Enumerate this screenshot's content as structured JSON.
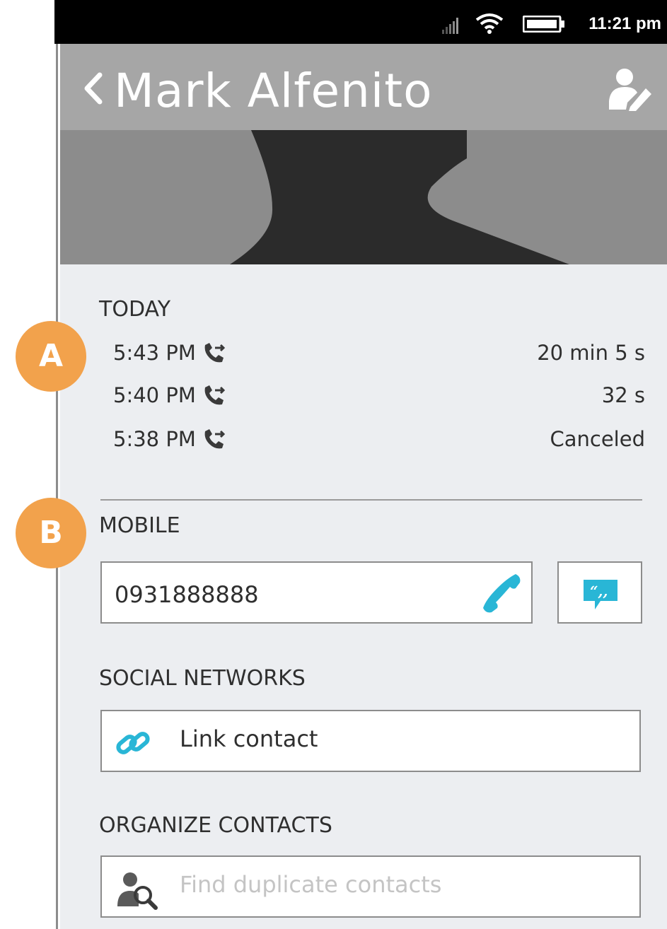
{
  "status": {
    "clock": "11:21 pm"
  },
  "header": {
    "title": "Mark Alfenito"
  },
  "today": {
    "label": "TODAY",
    "calls": [
      {
        "time": "5:43 PM",
        "duration": "20 min 5 s"
      },
      {
        "time": "5:40 PM",
        "duration": "32 s"
      },
      {
        "time": "5:38 PM",
        "duration": "Canceled"
      }
    ]
  },
  "mobile": {
    "label": "MOBILE",
    "number": "0931888888"
  },
  "social": {
    "label": "SOCIAL NETWORKS",
    "link_label": "Link contact"
  },
  "organize": {
    "label": "ORGANIZE CONTACTS",
    "find_label": "Find duplicate contacts"
  },
  "annotations": {
    "a": "A",
    "b": "B"
  },
  "colors": {
    "accent": "#29b6d6",
    "badge": "#f2a24c",
    "header_bg": "#a6a6a6",
    "content_bg": "#eceef1"
  }
}
